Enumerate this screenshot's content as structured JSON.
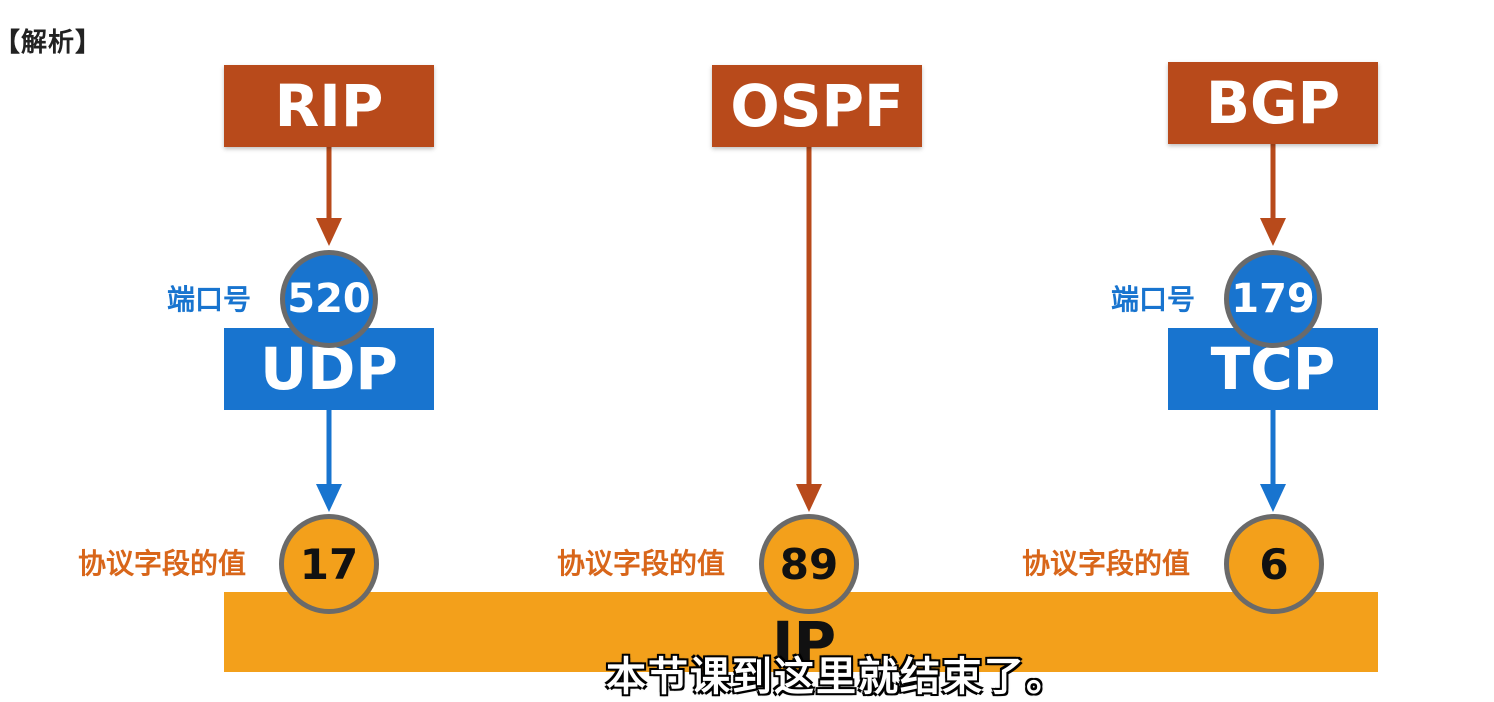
{
  "heading": "【解析】",
  "protocols": {
    "rip": "RIP",
    "ospf": "OSPF",
    "bgp": "BGP"
  },
  "transport": {
    "udp": "UDP",
    "tcp": "TCP"
  },
  "ports": {
    "label": "端口号",
    "rip_port": "520",
    "bgp_port": "179"
  },
  "protocol_field": {
    "label": "协议字段的值",
    "udp_value": "17",
    "ospf_value": "89",
    "tcp_value": "6"
  },
  "network": {
    "ip": "IP"
  },
  "subtitle": "本节课到这里就结束了。",
  "colors": {
    "app_box": "#b84a1b",
    "transport_box": "#1874cf",
    "ip_bar": "#f3a01b",
    "label_blue": "#1874cf",
    "label_orange": "#d8661a"
  }
}
